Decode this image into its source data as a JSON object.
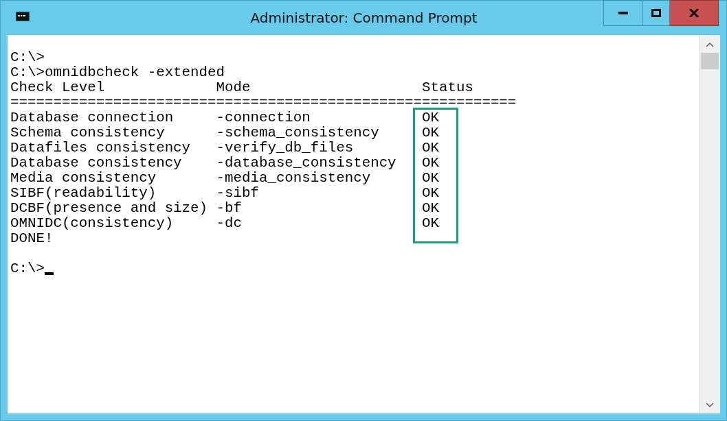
{
  "window": {
    "title": "Administrator: Command Prompt"
  },
  "console": {
    "lines_before": [
      "C:\\>",
      "C:\\>omnidbcheck -extended"
    ],
    "header": {
      "check_level": "Check Level",
      "mode": "Mode",
      "status": "Status"
    },
    "separator": "===========================================================",
    "rows": [
      {
        "check": "Database connection",
        "mode": "-connection",
        "status": "OK"
      },
      {
        "check": "Schema consistency",
        "mode": "-schema_consistency",
        "status": "OK"
      },
      {
        "check": "Datafiles consistency",
        "mode": "-verify_db_files",
        "status": "OK"
      },
      {
        "check": "Database consistency",
        "mode": "-database_consistency",
        "status": "OK"
      },
      {
        "check": "Media consistency",
        "mode": "-media_consistency",
        "status": "OK"
      },
      {
        "check": "SIBF(readability)",
        "mode": "-sibf",
        "status": "OK"
      },
      {
        "check": "DCBF(presence and size)",
        "mode": "-bf",
        "status": "OK"
      },
      {
        "check": "OMNIDC(consistency)",
        "mode": "-dc",
        "status": "OK"
      }
    ],
    "done": "DONE!",
    "prompt": "C:\\>"
  }
}
